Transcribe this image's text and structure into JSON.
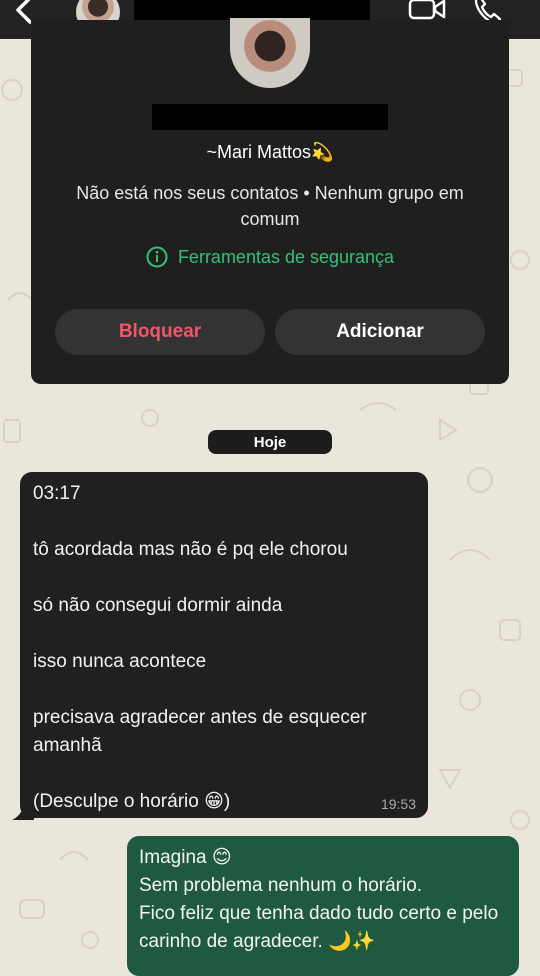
{
  "header": {
    "back_icon": "chevron-left-icon",
    "video_icon": "video-camera-icon",
    "phone_icon": "phone-icon"
  },
  "contact_card": {
    "name": "~Mari Mattos💫",
    "not_in_contacts": "Não está nos seus contatos • Nenhum grupo em comum",
    "safety_tools": "Ferramentas de segurança",
    "block_label": "Bloquear",
    "add_label": "Adicionar",
    "colors": {
      "block": "#f0566a",
      "safety": "#35c174"
    }
  },
  "date_chip": "Hoje",
  "messages": {
    "incoming": {
      "text": "03:17\n\ntô acordada mas não é pq ele chorou\n\nsó não consegui dormir ainda\n\nisso nunca acontece\n\nprecisava agradecer antes de esquecer amanhã\n\n(Desculpe o horário 😁)",
      "time": "19:53"
    },
    "outgoing": {
      "text": "Imagina 😊\nSem problema nenhum o horário.\nFico feliz que tenha dado tudo certo e pelo carinho de agradecer. 🌙✨",
      "color": "#1f5a40"
    }
  }
}
